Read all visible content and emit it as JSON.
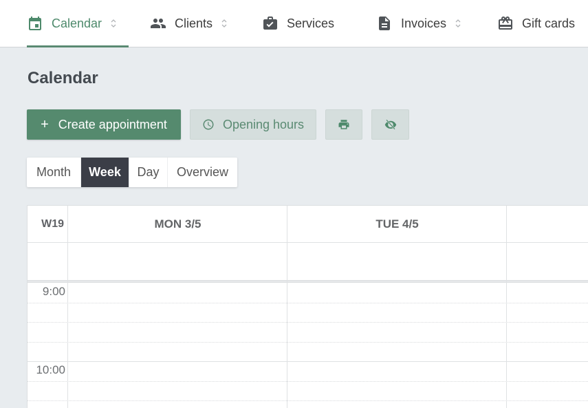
{
  "nav": {
    "items": [
      {
        "label": "Calendar",
        "icon": "calendar-icon",
        "active": true,
        "has_sort": true
      },
      {
        "label": "Clients",
        "icon": "people-icon",
        "active": false,
        "has_sort": true
      },
      {
        "label": "Services",
        "icon": "briefcase-check-icon",
        "active": false,
        "has_sort": false
      },
      {
        "label": "Invoices",
        "icon": "document-icon",
        "active": false,
        "has_sort": true
      },
      {
        "label": "Gift cards",
        "icon": "gift-card-icon",
        "active": false,
        "has_sort": false
      }
    ]
  },
  "page": {
    "title": "Calendar"
  },
  "toolbar": {
    "create_label": "Create appointment",
    "create_icon": "plus-icon",
    "opening_hours_label": "Opening hours",
    "opening_hours_icon": "clock-icon",
    "print_icon": "printer-icon",
    "hide_icon": "eye-off-icon"
  },
  "views": {
    "options": [
      "Month",
      "Week",
      "Day",
      "Overview"
    ],
    "selected": "Week"
  },
  "calendar": {
    "week_label": "W19",
    "days": [
      "MON 3/5",
      "TUE 4/5",
      ""
    ],
    "time_slots": [
      "9:00",
      "10:00"
    ]
  },
  "colors": {
    "accent": "#558a6e",
    "active_nav": "#4e8a6c",
    "selected_view": "#3b3e47",
    "background": "#e8ecef"
  }
}
